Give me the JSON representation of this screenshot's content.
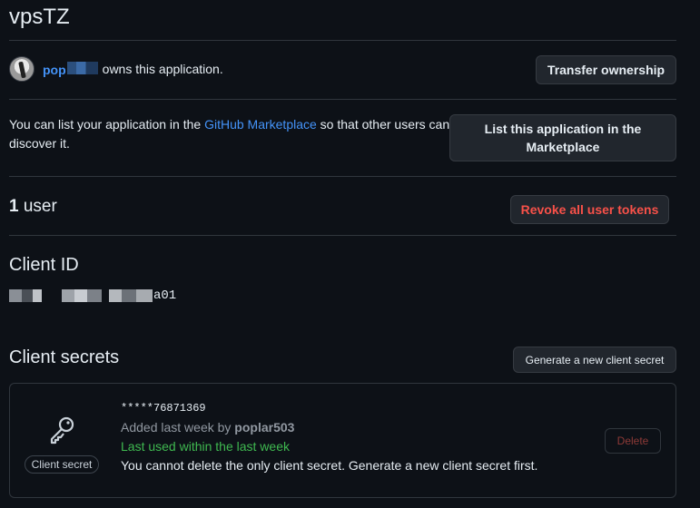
{
  "app": {
    "title": "vpsTZ"
  },
  "owner": {
    "name_visible": "pop",
    "owns_text": "owns this application.",
    "transfer_label": "Transfer ownership"
  },
  "marketplace": {
    "text_before": "You can list your application in the ",
    "link_text": "GitHub Marketplace",
    "text_after": " so that other users can discover it.",
    "button_label": "List this application in the Marketplace"
  },
  "users": {
    "count": "1",
    "label": " user",
    "revoke_label": "Revoke all user tokens"
  },
  "client_id": {
    "heading": "Client ID",
    "visible_suffix": "a01"
  },
  "client_secrets": {
    "heading": "Client secrets",
    "generate_label": "Generate a new client secret",
    "secret": {
      "badge": "Client secret",
      "hash": "*****76871369",
      "added_prefix": "Added last week by ",
      "added_by": "poplar503",
      "last_used": "Last used within the last week",
      "note": "You cannot delete the only client secret. Generate a new client secret first.",
      "delete_label": "Delete"
    }
  },
  "colors": {
    "background": "#0d1117",
    "link": "#4493f8",
    "danger": "#f85149",
    "success": "#3fb950",
    "border": "#30363d"
  },
  "icons": {
    "avatar": "user-avatar",
    "key": "key-icon"
  }
}
